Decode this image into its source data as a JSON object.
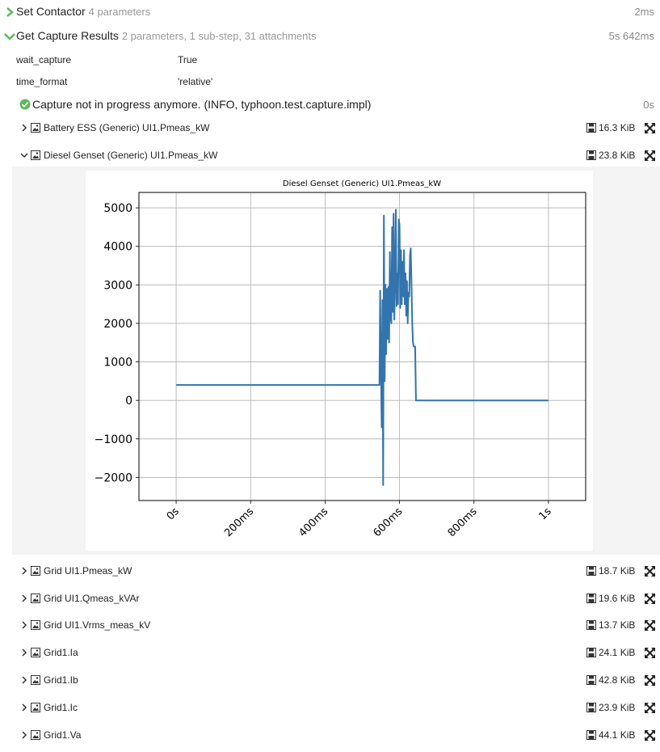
{
  "steps": [
    {
      "title": "Set Contactor",
      "sub": "4 parameters",
      "duration": "2ms",
      "expanded": false
    },
    {
      "title": "Get Capture Results",
      "sub": "2 parameters, 1 sub-step, 31 attachments",
      "duration": "5s 642ms",
      "expanded": true
    }
  ],
  "params": [
    {
      "key": "wait_capture",
      "value": "True"
    },
    {
      "key": "time_format",
      "value": "'relative'"
    }
  ],
  "log": {
    "message": "Capture not in progress anymore. (INFO, typhoon.test.capture.impl)",
    "duration": "0s",
    "status_color": "#5cb85c"
  },
  "attachments": [
    {
      "name": "Battery ESS (Generic) UI1.Pmeas_kW",
      "size": "16.3 KiB",
      "expanded": false
    },
    {
      "name": "Diesel Genset (Generic) UI1.Pmeas_kW",
      "size": "23.8 KiB",
      "expanded": true
    },
    {
      "name": "Grid UI1.Pmeas_kW",
      "size": "18.7 KiB",
      "expanded": false
    },
    {
      "name": "Grid UI1.Qmeas_kVAr",
      "size": "19.6 KiB",
      "expanded": false
    },
    {
      "name": "Grid UI1.Vrms_meas_kV",
      "size": "13.7 KiB",
      "expanded": false
    },
    {
      "name": "Grid1.Ia",
      "size": "24.1 KiB",
      "expanded": false
    },
    {
      "name": "Grid1.Ib",
      "size": "42.8 KiB",
      "expanded": false
    },
    {
      "name": "Grid1.Ic",
      "size": "23.9 KiB",
      "expanded": false
    },
    {
      "name": "Grid1.Va",
      "size": "44.1 KiB",
      "expanded": false
    }
  ],
  "colors": {
    "accent_green": "#5cb85c",
    "line": "#3274ae"
  },
  "chart_data": {
    "type": "line",
    "title": "Diesel Genset (Generic) UI1.Pmeas_kW",
    "xlabel": "",
    "ylabel": "",
    "xlim": [
      -100,
      1100
    ],
    "ylim": [
      -2600,
      5400
    ],
    "xticks": [
      0,
      200,
      400,
      600,
      800,
      1000
    ],
    "xtick_labels": [
      "0s",
      "200ms",
      "400ms",
      "600ms",
      "800ms",
      "1s"
    ],
    "yticks": [
      -2000,
      -1000,
      0,
      1000,
      2000,
      3000,
      4000,
      5000
    ],
    "ytick_labels": [
      "−2000",
      "−1000",
      "0",
      "1000",
      "2000",
      "3000",
      "4000",
      "5000"
    ],
    "grid": true,
    "x": [
      0,
      546,
      548,
      550,
      552,
      554,
      556,
      558,
      560,
      562,
      564,
      566,
      568,
      570,
      572,
      574,
      576,
      578,
      580,
      582,
      584,
      586,
      588,
      590,
      592,
      594,
      596,
      598,
      600,
      602,
      604,
      606,
      608,
      610,
      612,
      614,
      616,
      618,
      620,
      622,
      624,
      626,
      628,
      630,
      632,
      634,
      636,
      638,
      640,
      642,
      644,
      646,
      648,
      1000
    ],
    "y": [
      400,
      400,
      2850,
      1000,
      -700,
      2600,
      -2200,
      4800,
      500,
      3000,
      1200,
      2900,
      1600,
      2950,
      1500,
      3850,
      2200,
      2000,
      4500,
      2300,
      4850,
      2100,
      3200,
      4950,
      2450,
      3300,
      2500,
      4700,
      4550,
      2400,
      3900,
      2500,
      3600,
      2700,
      3900,
      2500,
      3300,
      2200,
      3100,
      2000,
      2800,
      2700,
      3750,
      3950,
      3100,
      2000,
      1500,
      1400,
      1400,
      1400,
      0,
      0,
      0,
      0
    ]
  }
}
